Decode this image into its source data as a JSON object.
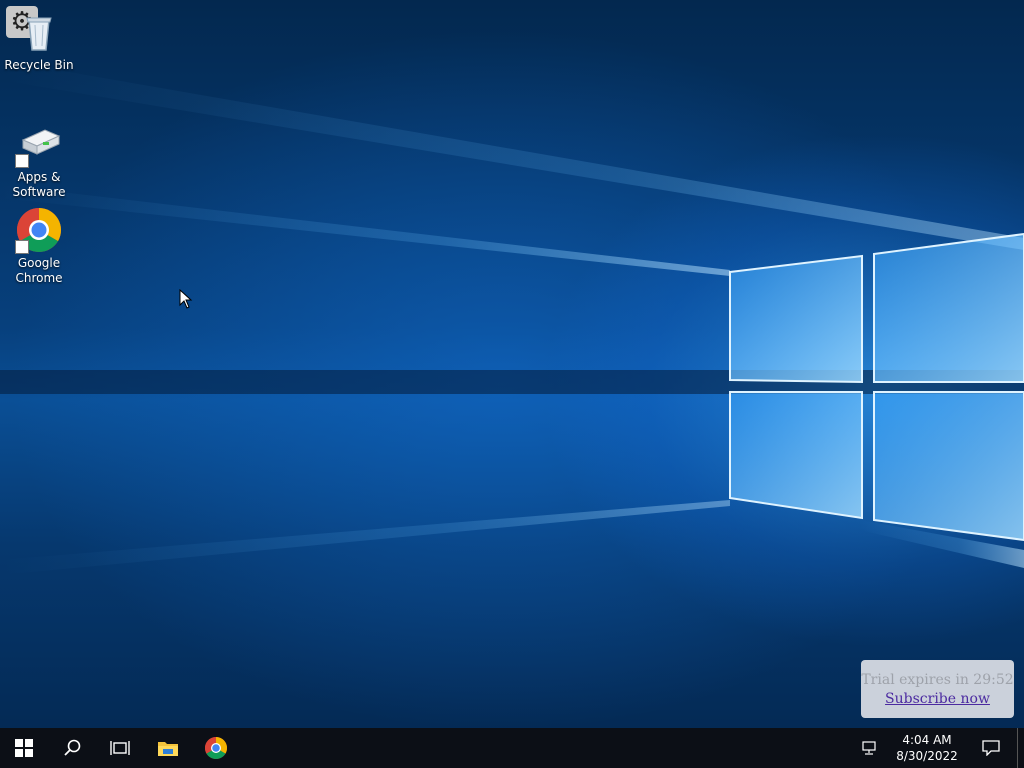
{
  "desktop": {
    "icons": [
      {
        "label": "Recycle Bin",
        "icon": "recycle-bin-icon"
      },
      {
        "label": "Apps & Software",
        "icon": "apps-software-icon"
      },
      {
        "label": "Google Chrome",
        "icon": "chrome-icon"
      }
    ],
    "settings_icon": "gear-icon",
    "settings_glyph": "⚙"
  },
  "trial": {
    "text": "Trial expires in 29:52",
    "link": "Subscribe now"
  },
  "taskbar": {
    "buttons": [
      {
        "icon": "windows-start-icon"
      },
      {
        "icon": "search-icon"
      },
      {
        "icon": "task-view-icon"
      },
      {
        "icon": "file-explorer-icon"
      },
      {
        "icon": "chrome-icon"
      }
    ],
    "tray": {
      "network_icon": "network-icon",
      "time": "4:04 AM",
      "date": "8/30/2022",
      "notification_icon": "notification-icon"
    }
  },
  "colors": {
    "taskbar": "#0c0f16",
    "accent": "#0a78d7",
    "link": "#4b2aa0"
  }
}
